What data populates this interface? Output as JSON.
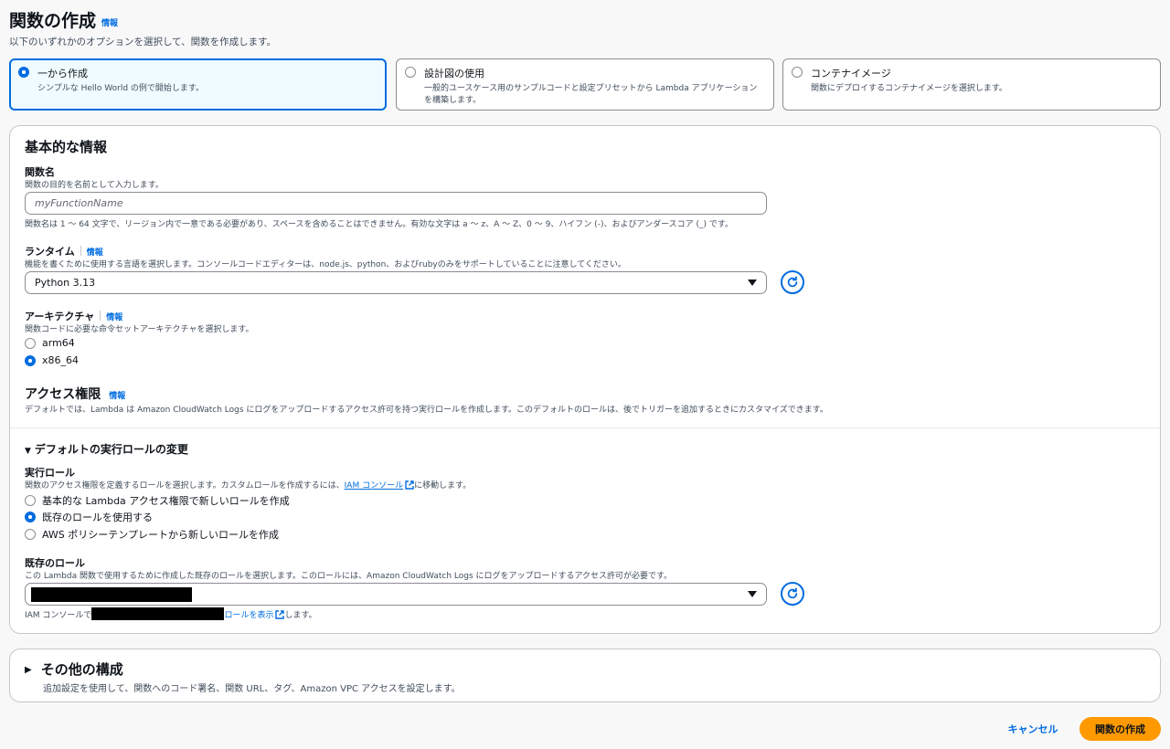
{
  "page": {
    "title": "関数の作成",
    "info": "情報",
    "subtitle": "以下のいずれかのオプションを選択して、関数を作成します。"
  },
  "options": [
    {
      "title": "一から作成",
      "desc": "シンプルな Hello World の例で開始します。",
      "selected": true
    },
    {
      "title": "設計図の使用",
      "desc": "一般的ユースケース用のサンプルコードと設定プリセットから Lambda アプリケーションを構築します。",
      "selected": false
    },
    {
      "title": "コンテナイメージ",
      "desc": "関数にデプロイするコンテナイメージを選択します。",
      "selected": false
    }
  ],
  "basic": {
    "heading": "基本的な情報",
    "function_name": {
      "label": "関数名",
      "desc": "関数の目的を名前として入力します。",
      "placeholder": "myFunctionName",
      "hint": "関数名は 1 〜 64 文字で、リージョン内で一意である必要があり、スペースを含めることはできません。有効な文字は a 〜 z、A 〜 Z、0 〜 9、ハイフン (-)、およびアンダースコア (_) です。"
    },
    "runtime": {
      "label": "ランタイム",
      "info": "情報",
      "desc": "機能を書くために使用する言語を選択します。コンソールコードエディターは、node.js、python、およびrubyのみをサポートしていることに注意してください。",
      "value": "Python 3.13"
    },
    "architecture": {
      "label": "アーキテクチャ",
      "info": "情報",
      "desc": "関数コードに必要な命令セットアーキテクチャを選択します。",
      "options": [
        {
          "label": "arm64",
          "selected": false
        },
        {
          "label": "x86_64",
          "selected": true
        }
      ]
    },
    "permissions": {
      "heading": "アクセス権限",
      "info": "情報",
      "desc": "デフォルトでは、Lambda は Amazon CloudWatch Logs にログをアップロードするアクセス許可を持つ実行ロールを作成します。このデフォルトのロールは、後でトリガーを追加するときにカスタマイズできます。"
    },
    "role_change": {
      "toggle": "デフォルトの実行ロールの変更",
      "exec_role_label": "実行ロール",
      "exec_role_desc_before": "関数のアクセス権限を定義するロールを選択します。カスタムロールを作成するには、",
      "exec_role_link": "IAM コンソール",
      "exec_role_desc_after": "に移動します。",
      "options": [
        {
          "label": "基本的な Lambda アクセス権限で新しいロールを作成",
          "selected": false
        },
        {
          "label": "既存のロールを使用する",
          "selected": true
        },
        {
          "label": "AWS ポリシーテンプレートから新しいロールを作成",
          "selected": false
        }
      ],
      "existing_label": "既存のロール",
      "existing_desc": "この Lambda 関数で使用するために作成した既存のロールを選択します。このロールには、Amazon CloudWatch Logs にログをアップロードするアクセス許可が必要です。",
      "footer_before": "IAM コンソールで",
      "footer_link": "ロールを表示",
      "footer_after": "します。"
    }
  },
  "other": {
    "heading": "その他の構成",
    "desc": "追加設定を使用して、関数へのコード署名、関数 URL、タグ、Amazon VPC アクセスを設定します。"
  },
  "footer": {
    "cancel": "キャンセル",
    "create": "関数の作成"
  },
  "colors": {
    "accent": "#006ce0",
    "primary_button": "#ff9900"
  }
}
